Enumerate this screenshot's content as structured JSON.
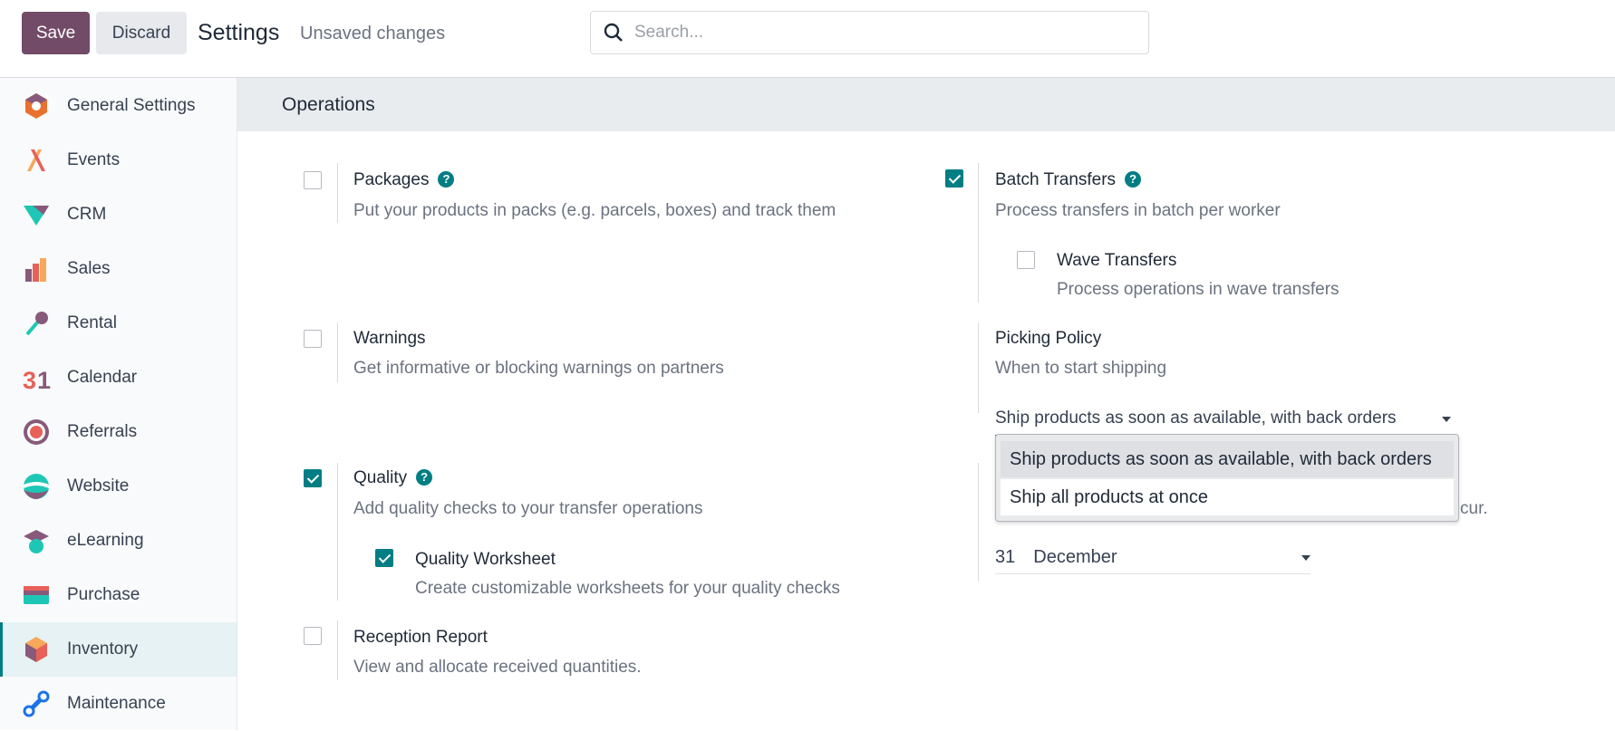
{
  "header": {
    "save_label": "Save",
    "discard_label": "Discard",
    "title": "Settings",
    "status": "Unsaved changes",
    "search_placeholder": "Search..."
  },
  "sidebar": {
    "active": "Inventory",
    "items": [
      {
        "label": "General Settings",
        "icon": "general-settings-icon"
      },
      {
        "label": "Events",
        "icon": "events-icon"
      },
      {
        "label": "CRM",
        "icon": "crm-icon"
      },
      {
        "label": "Sales",
        "icon": "sales-icon"
      },
      {
        "label": "Rental",
        "icon": "rental-icon"
      },
      {
        "label": "Calendar",
        "icon": "calendar-icon"
      },
      {
        "label": "Referrals",
        "icon": "referrals-icon"
      },
      {
        "label": "Website",
        "icon": "website-icon"
      },
      {
        "label": "eLearning",
        "icon": "elearning-icon"
      },
      {
        "label": "Purchase",
        "icon": "purchase-icon"
      },
      {
        "label": "Inventory",
        "icon": "inventory-icon"
      },
      {
        "label": "Maintenance",
        "icon": "maintenance-icon"
      }
    ]
  },
  "section": {
    "title": "Operations"
  },
  "settings": {
    "packages": {
      "title": "Packages",
      "desc": "Put your products in packs (e.g. parcels, boxes) and track them",
      "checked": false
    },
    "batch": {
      "title": "Batch Transfers",
      "desc": "Process transfers in batch per worker",
      "checked": true
    },
    "wave": {
      "title": "Wave Transfers",
      "desc": "Process operations in wave transfers",
      "checked": false
    },
    "warnings": {
      "title": "Warnings",
      "desc": "Get informative or blocking warnings on partners",
      "checked": false
    },
    "picking": {
      "title": "Picking Policy",
      "desc": "When to start shipping",
      "value": "Ship products as soon as available, with back orders",
      "options": [
        "Ship products as soon as available, with back orders",
        "Ship all products at once"
      ]
    },
    "quality": {
      "title": "Quality",
      "desc": "Add quality checks to your transfer operations",
      "checked": true
    },
    "worksheet": {
      "title": "Quality Worksheet",
      "desc": "Create customizable worksheets for your quality checks",
      "checked": true
    },
    "annual": {
      "desc_fragment": "cur.",
      "day": "31",
      "month": "December"
    },
    "reception": {
      "title": "Reception Report",
      "desc": "View and allocate received quantities.",
      "checked": false
    }
  },
  "colors": {
    "brand": "#714b67",
    "accent": "#017e84"
  }
}
